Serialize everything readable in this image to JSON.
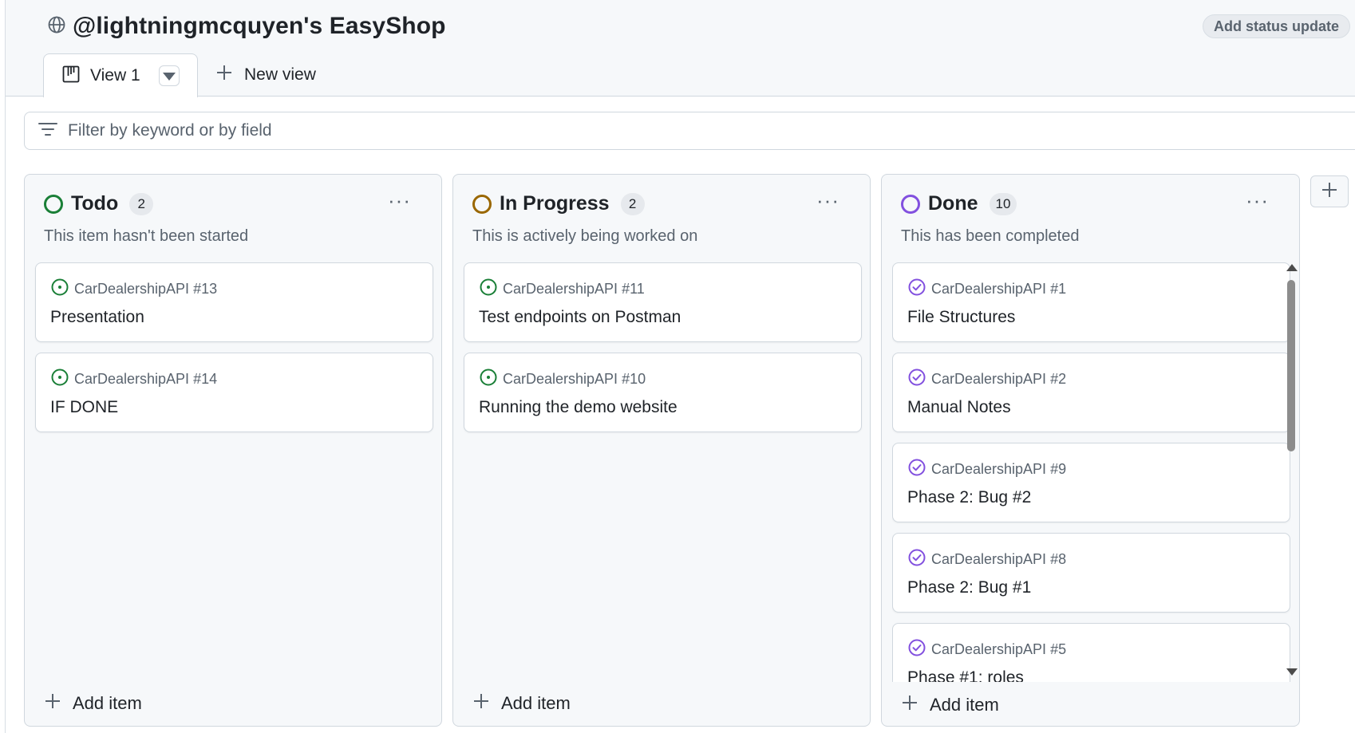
{
  "header": {
    "title": "@lightningmcquyen's EasyShop",
    "status_update_label": "Add status update"
  },
  "tabs": {
    "active_label": "View 1",
    "new_view_label": "New view"
  },
  "filter": {
    "placeholder": "Filter by keyword or by field"
  },
  "columns": [
    {
      "title": "Todo",
      "count": "2",
      "description": "This item hasn't been started",
      "color": "#1a7f37",
      "add_item_label": "Add item",
      "cards": [
        {
          "ref": "CarDealershipAPI #13",
          "title": "Presentation"
        },
        {
          "ref": "CarDealershipAPI #14",
          "title": "IF DONE"
        }
      ]
    },
    {
      "title": "In Progress",
      "count": "2",
      "description": "This is actively being worked on",
      "color": "#9a6700",
      "add_item_label": "Add item",
      "cards": [
        {
          "ref": "CarDealershipAPI #11",
          "title": "Test endpoints on Postman"
        },
        {
          "ref": "CarDealershipAPI #10",
          "title": "Running the demo website"
        }
      ]
    },
    {
      "title": "Done",
      "count": "10",
      "description": "This has been completed",
      "color": "#8250df",
      "add_item_label": "Add item",
      "cards": [
        {
          "ref": "CarDealershipAPI #1",
          "title": "File Structures"
        },
        {
          "ref": "CarDealershipAPI #2",
          "title": "Manual Notes"
        },
        {
          "ref": "CarDealershipAPI #9",
          "title": "Phase 2: Bug #2"
        },
        {
          "ref": "CarDealershipAPI #8",
          "title": "Phase 2: Bug #1"
        },
        {
          "ref": "CarDealershipAPI #5",
          "title": "Phase #1: roles"
        }
      ]
    }
  ],
  "icons": {
    "header": "globe-icon",
    "tab": "board-view-icon",
    "filter": "filter-icon",
    "open_issue": "issue-open-icon",
    "closed_issue": "issue-closed-icon",
    "add": "plus-icon",
    "menu": "kebab-horizontal-icon"
  }
}
